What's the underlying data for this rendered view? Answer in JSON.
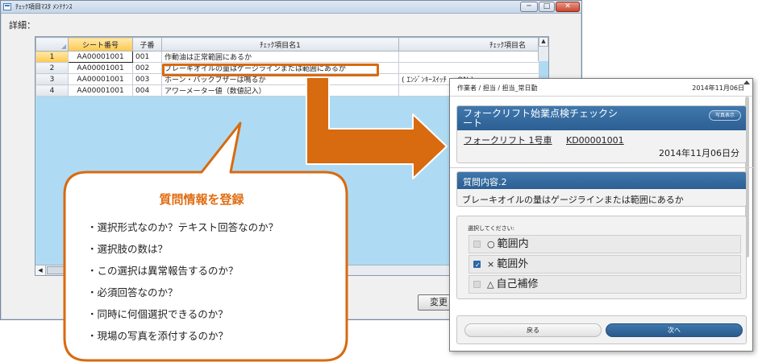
{
  "window": {
    "title": "ﾁｪｯｸ項目ﾏｽﾀ ﾒﾝﾃﾅﾝｽ",
    "detail_label": "詳細：",
    "buttons": {
      "minimize": "─",
      "maximize": "□",
      "close": "✕"
    },
    "change_button": "変更"
  },
  "grid": {
    "columns": [
      "シート番号",
      "子番",
      "ﾁｪｯｸ項目名1",
      "ﾁｪｯｸ項目名"
    ],
    "rows": [
      {
        "num": "1",
        "sheet": "AA00001001",
        "sub": "001",
        "name1": "作動油は正常範囲にあるか",
        "name2": ""
      },
      {
        "num": "2",
        "sheet": "AA00001001",
        "sub": "002",
        "name1": "ブレーキオイルの量はゲージラインまたは範囲にあるか",
        "name2": ""
      },
      {
        "num": "3",
        "sheet": "AA00001001",
        "sub": "003",
        "name1": "ホーン・バックブザーは鳴るか",
        "name2": "( ｴﾝｼﾞﾝｷｰｽｲｯﾁ = ON )"
      },
      {
        "num": "4",
        "sheet": "AA00001001",
        "sub": "004",
        "name1": "アワーメーター値（数値記入）",
        "name2": ""
      }
    ]
  },
  "bubble": {
    "title": "質問情報を登録",
    "items": [
      "・選択形式なのか？テキスト回答なのか？",
      "・選択肢の数は？",
      "・この選択は異常報告するのか？",
      "・必須回答なのか？",
      "・同時に何個選択できるのか？",
      "・現場の写真を添付するのか？"
    ]
  },
  "mobile": {
    "header_left": "作業者 / 担当 / 担当_常日勤",
    "header_right": "2014年11月06日",
    "sheet_title": "フォークリフト始業点検チェックシート",
    "photo_button": "写真表示",
    "vehicle_name": "フォークリフト 1号車",
    "vehicle_code": "KD00001001",
    "date": "2014年11月06日分",
    "question_header": "質問内容.2",
    "question_text": "ブレーキオイルの量はゲージラインまたは範囲にあるか",
    "select_label": "選択してください:",
    "options": [
      {
        "symbol": "○",
        "label": "範囲内",
        "checked": false
      },
      {
        "symbol": "×",
        "label": "範囲外",
        "checked": true
      },
      {
        "symbol": "△",
        "label": "自己補修",
        "checked": false
      }
    ],
    "back_button": "戻る",
    "next_button": "次へ"
  },
  "colors": {
    "accent": "#d86a10",
    "bubble_fill": "#ffffff",
    "mobile_header": "#2d5f93",
    "grid_background": "#aedbf3"
  }
}
